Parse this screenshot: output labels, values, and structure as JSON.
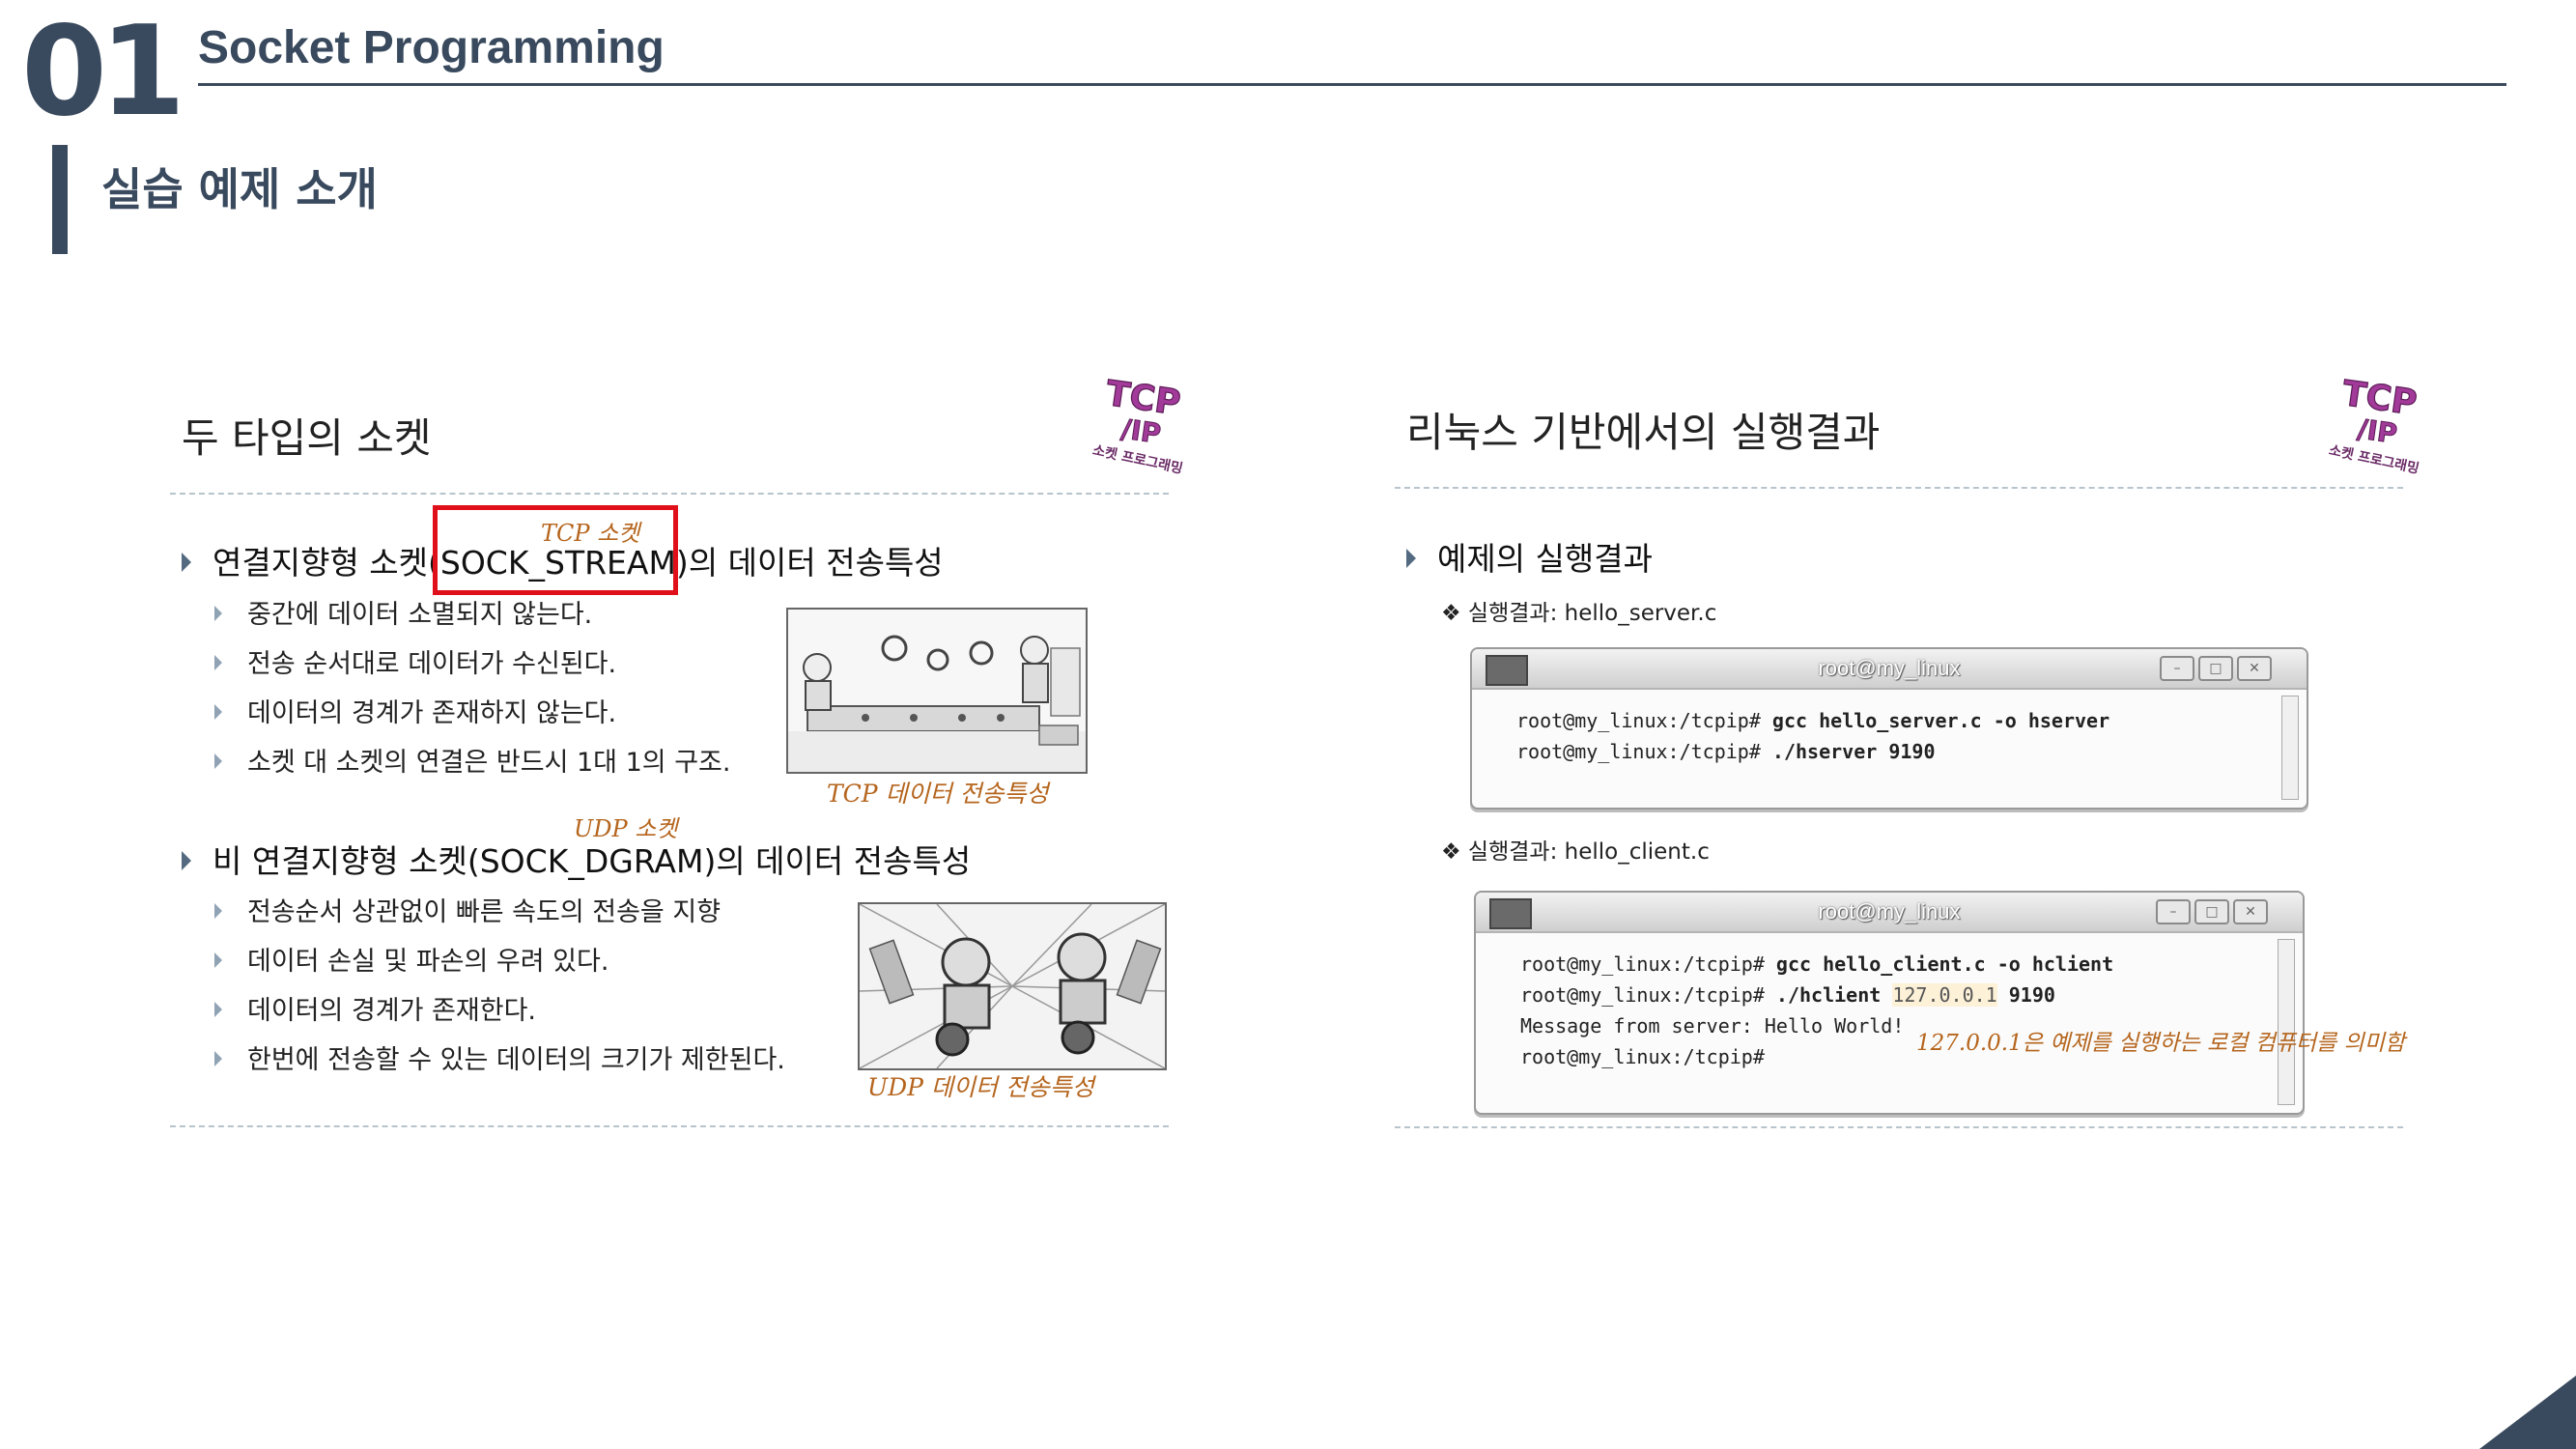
{
  "header": {
    "number": "01",
    "title": "Socket Programming",
    "subtitle": "실습 예제 소개"
  },
  "left": {
    "title": "두 타입의 소켓",
    "logo": {
      "name": "tcpip-logo",
      "top": "TCP",
      "bottom": "/IP",
      "caption": "소켓 프로그래밍"
    },
    "tcp": {
      "note": "TCP 소켓",
      "heading_pre": "연결지향형 소켓",
      "heading_box": "(SOCK_STREAM)",
      "heading_post": "의 데이터 전송특성",
      "items": [
        "중간에 데이터 소멸되지 않는다.",
        "전송 순서대로 데이터가 수신된다.",
        "데이터의 경계가 존재하지 않는다.",
        "소켓 대 소켓의 연결은 반드시 1대 1의 구조."
      ],
      "caption": "TCP 데이터 전송특성"
    },
    "udp": {
      "note": "UDP 소켓",
      "heading": "비 연결지향형 소켓(SOCK_DGRAM)의 데이터 전송특성",
      "items": [
        "전송순서 상관없이 빠른 속도의 전송을 지향",
        "데이터 손실 및 파손의 우려 있다.",
        "데이터의 경계가 존재한다.",
        "한번에 전송할 수 있는 데이터의 크기가 제한된다."
      ],
      "caption": "UDP 데이터 전송특성"
    }
  },
  "right": {
    "title": "리눅스 기반에서의 실행결과",
    "logo": {
      "name": "tcpip-logo",
      "top": "TCP",
      "bottom": "/IP",
      "caption": "소켓 프로그래밍"
    },
    "bullet": "예제의 실행결과",
    "server": {
      "label": "❖ 실행결과: hello_server.c",
      "window_title": "root@my_linux",
      "lines": [
        {
          "prompt": "root@my_linux:/tcpip#",
          "cmd": "gcc hello_server.c -o hserver"
        },
        {
          "prompt": "root@my_linux:/tcpip#",
          "cmd": "./hserver 9190"
        }
      ]
    },
    "client": {
      "label": "❖ 실행결과: hello_client.c",
      "window_title": "root@my_linux",
      "line1": {
        "prompt": "root@my_linux:/tcpip#",
        "cmd": "gcc hello_client.c -o hclient"
      },
      "line2": {
        "prompt": "root@my_linux:/tcpip#",
        "cmd": "./hclient",
        "ip": "127.0.0.1",
        "port": "9190"
      },
      "line3": "Message from server: Hello World!",
      "line4": "root@my_linux:/tcpip#",
      "annotation": "127.0.0.1은 예제를 실행하는 로컬 컴퓨터를 의미함"
    }
  },
  "colors": {
    "accent": "#3a4a5e",
    "highlight_box": "#e0101a",
    "note": "#b5651d"
  }
}
